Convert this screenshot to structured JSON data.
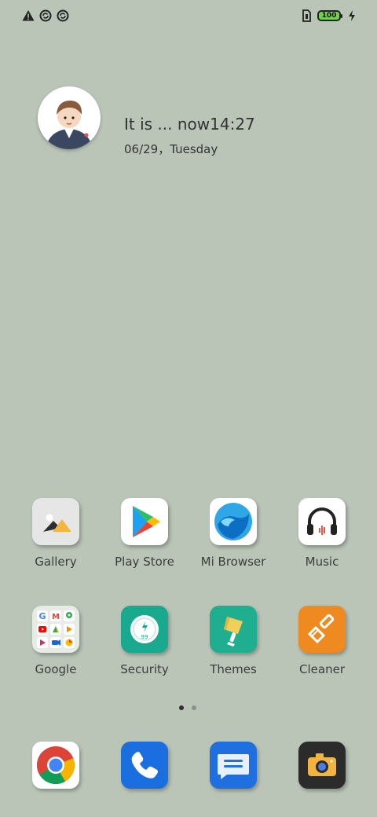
{
  "status_bar": {
    "left_icons": [
      "warning-icon",
      "sync-icon",
      "sync-icon"
    ],
    "battery_level": "100",
    "charging": true
  },
  "widget": {
    "greeting_time": "It is ... now14:27",
    "date": "06/29，Tuesday"
  },
  "apps": [
    {
      "label": "Gallery",
      "icon": "gallery-icon"
    },
    {
      "label": "Play Store",
      "icon": "play-store-icon"
    },
    {
      "label": "Mi Browser",
      "icon": "mi-browser-icon"
    },
    {
      "label": "Music",
      "icon": "music-icon"
    },
    {
      "label": "Google",
      "icon": "google-folder-icon"
    },
    {
      "label": "Security",
      "icon": "security-icon"
    },
    {
      "label": "Themes",
      "icon": "themes-icon"
    },
    {
      "label": "Cleaner",
      "icon": "cleaner-icon"
    }
  ],
  "page_indicator": {
    "pages": 2,
    "current": 1
  },
  "dock": [
    {
      "icon": "chrome-icon"
    },
    {
      "icon": "phone-icon"
    },
    {
      "icon": "messages-icon"
    },
    {
      "icon": "camera-icon"
    }
  ],
  "colors": {
    "wallpaper": "#bac5b8",
    "security": "#19a98e",
    "themes": "#1fae90",
    "cleaner": "#ee8a1f",
    "phone": "#1a6ee0",
    "messages": "#1f6fe0",
    "camera": "#2b2b2b"
  }
}
